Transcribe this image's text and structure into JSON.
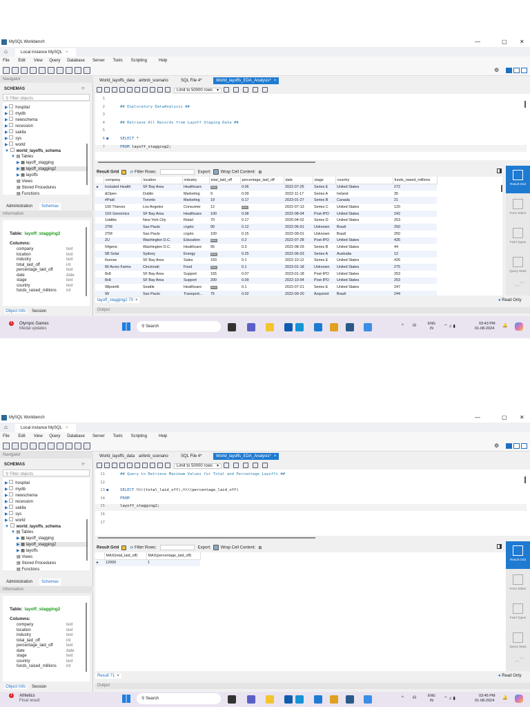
{
  "shots": [
    {
      "app_title": "MySQL Workbench",
      "connection_tab": "Local instance MySQL",
      "menu": [
        "File",
        "Edit",
        "View",
        "Query",
        "Database",
        "Server",
        "Tools",
        "Scripting",
        "Help"
      ],
      "navigator": {
        "header": "Navigator",
        "schemas_label": "SCHEMAS",
        "filter_placeholder": "Filter objects",
        "schemas": [
          "hospital",
          "mydb",
          "newschema",
          "recession",
          "sakila",
          "sys",
          "world"
        ],
        "open_schema": "world_layoffs_schema",
        "tables_label": "Tables",
        "tables": [
          "layoff_stagging",
          "layoff_stagging2",
          "layoffs"
        ],
        "other_nodes": [
          "Views",
          "Stored Procedures",
          "Functions"
        ],
        "bottom_tabs": [
          "Administration",
          "Schemas"
        ]
      },
      "information": {
        "header": "Information",
        "table_label": "Table:",
        "table_name": "layoff_stagging2",
        "columns_label": "Columns:",
        "columns": [
          [
            "company",
            "text"
          ],
          [
            "location",
            "text"
          ],
          [
            "industry",
            "text"
          ],
          [
            "total_laid_off",
            "int"
          ],
          [
            "percentage_laid_off",
            "text"
          ],
          [
            "date",
            "date"
          ],
          [
            "stage",
            "text"
          ],
          [
            "country",
            "text"
          ],
          [
            "funds_raised_millions",
            "int"
          ]
        ],
        "tabs": [
          "Object Info",
          "Session"
        ]
      },
      "editor_tabs": [
        "World_layoffs_data",
        "airbnb_scenario",
        "SQL File 4*",
        "World_layoffs_EDA_Analysis*"
      ],
      "active_editor_tab": 3,
      "limit_label": "Limit to 50000 rows",
      "code_lines": [
        {
          "n": "1",
          "parts": []
        },
        {
          "n": "2",
          "parts": [
            [
              "comment",
              "## Exploratory DataAnalysis ##"
            ]
          ]
        },
        {
          "n": "3",
          "parts": []
        },
        {
          "n": "4",
          "parts": [
            [
              "comment",
              "## Retrieve All Records from Layoff Staging Data ##"
            ]
          ]
        },
        {
          "n": "5",
          "parts": []
        },
        {
          "n": "6",
          "dot": true,
          "parts": [
            [
              "kw",
              "SELECT "
            ],
            [
              "",
              "*"
            ]
          ]
        },
        {
          "n": "7",
          "parts": [
            [
              "kw",
              "FROM "
            ],
            [
              "",
              "layoff_stagging2;"
            ]
          ]
        }
      ],
      "result_toolbar": {
        "result_grid": "Result Grid",
        "filter_rows": "Filter Rows:",
        "export": "Export:",
        "wrap": "Wrap Cell Content:"
      },
      "grid": {
        "headers": [
          "company",
          "location",
          "industry",
          "total_laid_off",
          "percentage_laid_off",
          "date",
          "stage",
          "country",
          "funds_raised_millions"
        ],
        "rows": [
          [
            "Included Health",
            "SF Bay Area",
            "Healthcare",
            "NULL",
            "0.06",
            "2022-07-25",
            "Series E",
            "United States",
            "272"
          ],
          [
            "&Open",
            "Dublin",
            "Marketing",
            "9",
            "0.09",
            "2022-11-17",
            "Series A",
            "Ireland",
            "35"
          ],
          [
            "#Paid",
            "Toronto",
            "Marketing",
            "19",
            "0.17",
            "2023-01-27",
            "Series B",
            "Canada",
            "21"
          ],
          [
            "100 Thieves",
            "Los Angeles",
            "Consumer",
            "12",
            "NULL",
            "2022-07-13",
            "Series C",
            "United States",
            "120"
          ],
          [
            "10X Genomics",
            "SF Bay Area",
            "Healthcare",
            "100",
            "0.08",
            "2022-08-04",
            "Post-IPO",
            "United States",
            "242"
          ],
          [
            "1stdibs",
            "New York City",
            "Retail",
            "70",
            "0.17",
            "2020-04-02",
            "Series D",
            "United States",
            "253"
          ],
          [
            "2TM",
            "Sao Paulo",
            "crypto",
            "90",
            "0.12",
            "2022-06-01",
            "Unknown",
            "Brazil",
            "250"
          ],
          [
            "2TM",
            "Sao Paulo",
            "crypto",
            "100",
            "0.15",
            "2022-09-01",
            "Unknown",
            "Brazil",
            "250"
          ],
          [
            "2U",
            "Washington D.C.",
            "Education",
            "NULL",
            "0.2",
            "2022-07-28",
            "Post-IPO",
            "United States",
            "426"
          ],
          [
            "54gene",
            "Washington D.C.",
            "Healthcare",
            "95",
            "0.3",
            "2022-08-29",
            "Series B",
            "United States",
            "44"
          ],
          [
            "5B Solar",
            "Sydney",
            "Energy",
            "NULL",
            "0.25",
            "2022-06-03",
            "Series A",
            "Australia",
            "12"
          ],
          [
            "6sense",
            "SF Bay Area",
            "Sales",
            "150",
            "0.1",
            "2022-10-12",
            "Series E",
            "United States",
            "426"
          ],
          [
            "80 Acres Farms",
            "Cincinnati",
            "Food",
            "NULL",
            "0.1",
            "2023-01-18",
            "Unknown",
            "United States",
            "275"
          ],
          [
            "8x8",
            "SF Bay Area",
            "Support",
            "155",
            "0.07",
            "2023-01-18",
            "Post-IPO",
            "United States",
            "253"
          ],
          [
            "8x8",
            "SF Bay Area",
            "Support",
            "200",
            "0.09",
            "2022-10-04",
            "Post-IPO",
            "United States",
            "253"
          ],
          [
            "98point6",
            "Seattle",
            "Healthcare",
            "NULL",
            "0.1",
            "2022-07-21",
            "Series E",
            "United States",
            "247"
          ],
          [
            "99",
            "Sao Paulo",
            "Transport...",
            "75",
            "0.02",
            "2022-09-20",
            "Acquired",
            "Brazil",
            "244"
          ]
        ]
      },
      "side_panel": [
        "Result Grid",
        "Form Editor",
        "Field Types",
        "Query Stats"
      ],
      "result_tab": "layoff_stagging2 70",
      "read_only": "Read Only",
      "output_label": "Output",
      "taskbar": {
        "news_title": "Olympic Games",
        "news_sub": "Medal updates",
        "badge": "1",
        "search": "Search",
        "lang1": "ENG",
        "lang2": "IN",
        "time": "03:43 PM",
        "date": "01-08-2024"
      }
    },
    {
      "app_title": "MySQL Workbench",
      "connection_tab": "Local instance MySQL",
      "menu": [
        "File",
        "Edit",
        "View",
        "Query",
        "Database",
        "Server",
        "Tools",
        "Scripting",
        "Help"
      ],
      "navigator": {
        "header": "Navigator",
        "schemas_label": "SCHEMAS",
        "filter_placeholder": "Filter objects",
        "schemas": [
          "hospital",
          "mydb",
          "newschema",
          "recession",
          "sakila",
          "sys",
          "world"
        ],
        "open_schema": "world_layoffs_schema",
        "tables_label": "Tables",
        "tables": [
          "layoff_stagging",
          "layoff_stagging2",
          "layoffs"
        ],
        "other_nodes": [
          "Views",
          "Stored Procedures",
          "Functions"
        ],
        "bottom_tabs": [
          "Administration",
          "Schemas"
        ]
      },
      "information": {
        "header": "Information",
        "table_label": "Table:",
        "table_name": "layoff_stagging2",
        "columns_label": "Columns:",
        "columns": [
          [
            "company",
            "text"
          ],
          [
            "location",
            "text"
          ],
          [
            "industry",
            "text"
          ],
          [
            "total_laid_off",
            "int"
          ],
          [
            "percentage_laid_off",
            "text"
          ],
          [
            "date",
            "date"
          ],
          [
            "stage",
            "text"
          ],
          [
            "country",
            "text"
          ],
          [
            "funds_raised_millions",
            "int"
          ]
        ],
        "tabs": [
          "Object Info",
          "Session"
        ]
      },
      "editor_tabs": [
        "World_layoffs_data",
        "airbnb_scenario",
        "SQL File 4*",
        "World_layoffs_EDA_Analysis*"
      ],
      "active_editor_tab": 3,
      "limit_label": "Limit to 50000 rows",
      "code_lines": [
        {
          "n": "11",
          "parts": [
            [
              "comment",
              "## Query to Retrieve Maximum Values for Total and Percentage Layoffs ##"
            ]
          ]
        },
        {
          "n": "12",
          "parts": []
        },
        {
          "n": "13",
          "dot": true,
          "parts": [
            [
              "kw",
              "SELECT "
            ],
            [
              "fn",
              "MAX"
            ],
            [
              "",
              "(total_laid_off),"
            ],
            [
              "fn",
              "MAX"
            ],
            [
              "",
              "(percentage_laid_off)"
            ]
          ]
        },
        {
          "n": "14",
          "parts": [
            [
              "kw",
              "FROM"
            ]
          ]
        },
        {
          "n": "15",
          "parts": [
            [
              "",
              "layoff_stagging2;"
            ]
          ]
        },
        {
          "n": "16",
          "parts": []
        },
        {
          "n": "17",
          "parts": []
        }
      ],
      "result_toolbar": {
        "result_grid": "Result Grid",
        "filter_rows": "Filter Rows:",
        "export": "Export:",
        "wrap": "Wrap Cell Content:"
      },
      "grid": {
        "headers": [
          "MAX(total_laid_off)",
          "MAX(percentage_laid_off)"
        ],
        "rows": [
          [
            "12000",
            "1"
          ]
        ]
      },
      "side_panel": [
        "Result Grid",
        "Form Editor",
        "Field Types",
        "Query Stats"
      ],
      "result_tab": "Result 71",
      "read_only": "Read Only",
      "output_label": "Output",
      "taskbar": {
        "news_title": "Athletics",
        "news_sub": "Final result",
        "badge": "1",
        "search": "Search",
        "lang1": "ENG",
        "lang2": "IN",
        "time": "03:45 PM",
        "date": "01-08-2024"
      }
    }
  ]
}
